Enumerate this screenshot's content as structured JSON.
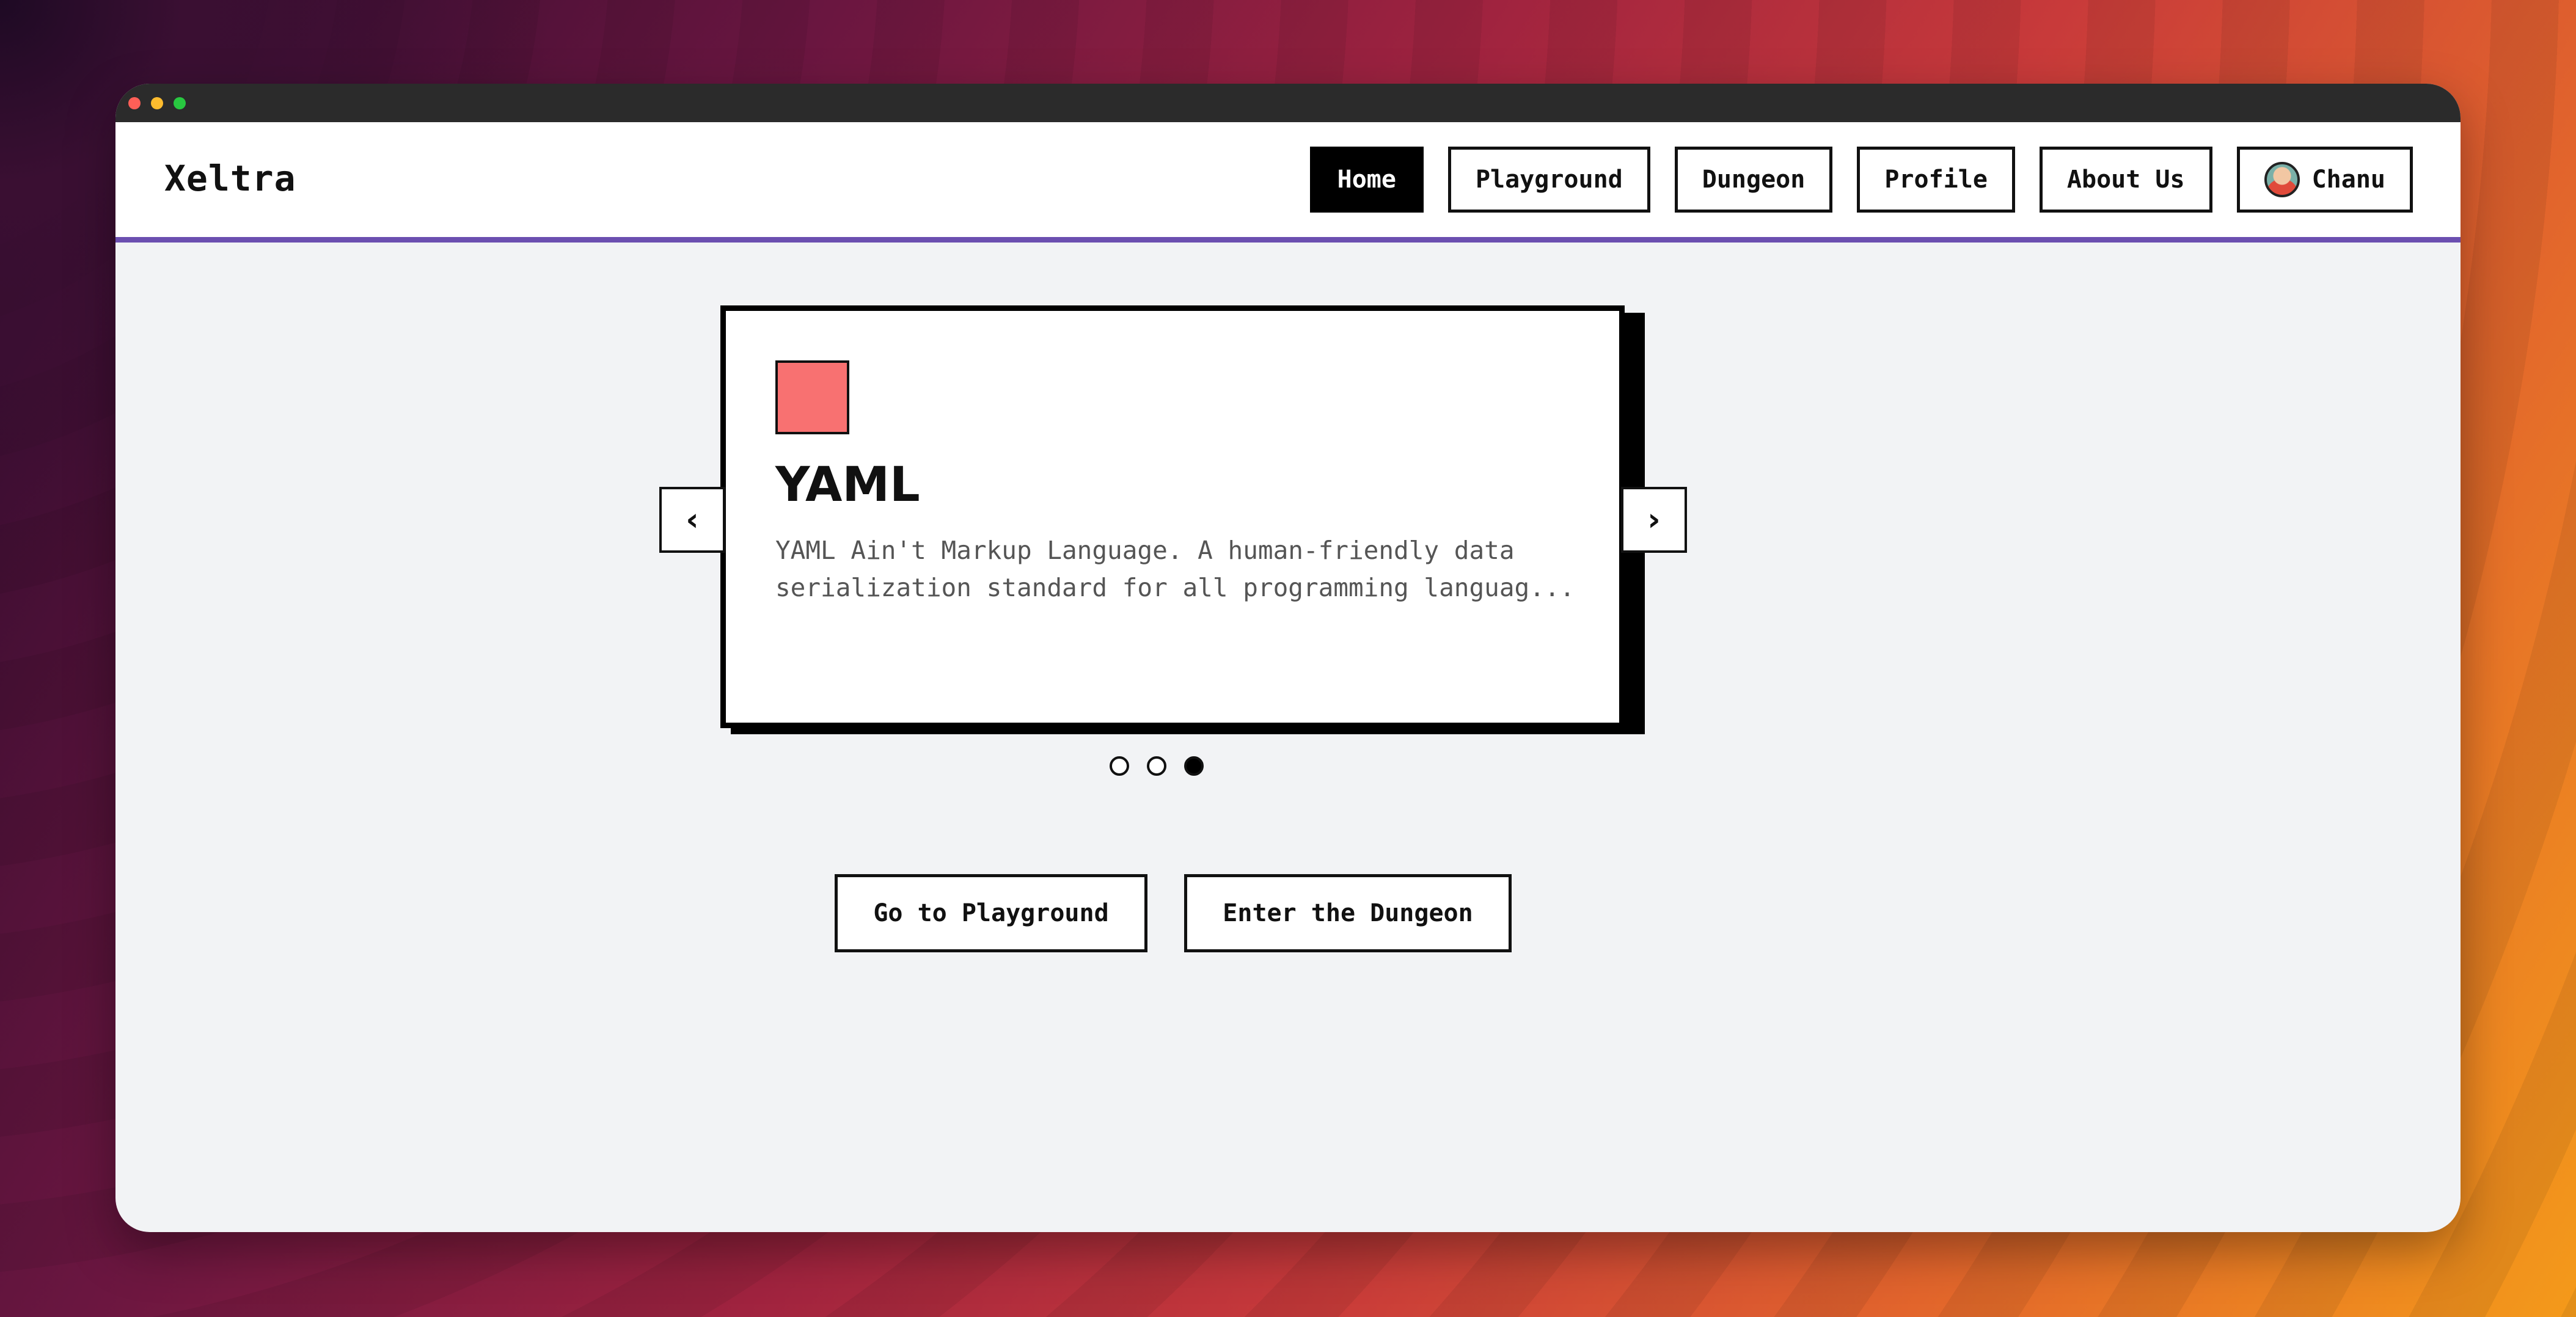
{
  "window": {
    "controls": [
      "close",
      "minimize",
      "maximize"
    ]
  },
  "navbar": {
    "brand": "Xeltra",
    "links": [
      {
        "label": "Home",
        "active": true
      },
      {
        "label": "Playground",
        "active": false
      },
      {
        "label": "Dungeon",
        "active": false
      },
      {
        "label": "Profile",
        "active": false
      },
      {
        "label": "About Us",
        "active": false
      }
    ],
    "user": {
      "name": "Chanu",
      "avatar_icon": "user-avatar"
    }
  },
  "carousel": {
    "card": {
      "swatch_color": "#f87171",
      "title": "YAML",
      "description": "YAML Ain't Markup Language. A human-friendly data serialization standard for all programming languag..."
    },
    "prev_icon": "chevron-left-icon",
    "next_icon": "chevron-right-icon",
    "prev_glyph": "‹",
    "next_glyph": "›",
    "slide_count": 3,
    "active_index": 2
  },
  "actions": {
    "playground_label": "Go to Playground",
    "dungeon_label": "Enter the Dungeon"
  },
  "colors": {
    "accent": "#6b4fb0",
    "active_nav_bg": "#000000",
    "page_bg": "#f2f3f5"
  }
}
